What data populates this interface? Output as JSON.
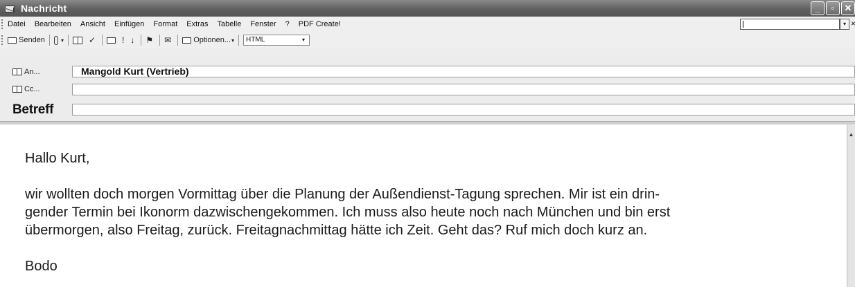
{
  "window": {
    "title": "Nachricht",
    "min_icon": "minimize-icon",
    "max_icon": "restore-icon",
    "close_icon": "close-icon",
    "min_glyph": "_",
    "max_glyph": "▫",
    "close_glyph": "✕"
  },
  "menubar": {
    "items": [
      "Datei",
      "Bearbeiten",
      "Ansicht",
      "Einfügen",
      "Format",
      "Extras",
      "Tabelle",
      "Fenster",
      "?",
      "PDF Create!"
    ],
    "search_value": "",
    "close_glyph": "×"
  },
  "toolbar": {
    "send_label": "Senden",
    "options_label": "Optionen...",
    "format_value": "HTML",
    "dropdown_glyph": "▾",
    "glyphs": {
      "check_names": "✓",
      "importance_high": "!",
      "importance_low": "↓",
      "flag": "⚑",
      "permission": "✉"
    }
  },
  "header": {
    "to_label": "An...",
    "to_value": "Mangold Kurt (Vertrieb)",
    "cc_label": "Cc...",
    "cc_value": "",
    "subject_label": "Betreff",
    "subject_value": ""
  },
  "body": {
    "greeting": "Hallo Kurt,",
    "paragraph": "wir wollten doch morgen Vormittag über die Planung der Außendienst-Tagung sprechen. Mir ist ein drin-gender Termin bei Ikonorm dazwischengekommen. Ich muss also heute noch nach München und bin erst übermorgen, also Freitag, zurück. Freitagnachmittag hätte ich Zeit. Geht das? Ruf mich doch kurz an.",
    "paragraph_lines": [
      "wir wollten doch morgen Vormittag über die Planung der Außendienst-Tagung sprechen. Mir ist ein drin-",
      "gender Termin bei Ikonorm dazwischengekommen. Ich muss also heute noch nach München und bin erst",
      "übermorgen, also Freitag, zurück. Freitagnachmittag hätte ich Zeit. Geht das? Ruf mich doch kurz an."
    ],
    "signature": "Bodo"
  },
  "scrollbar": {
    "up_glyph": "▲"
  }
}
